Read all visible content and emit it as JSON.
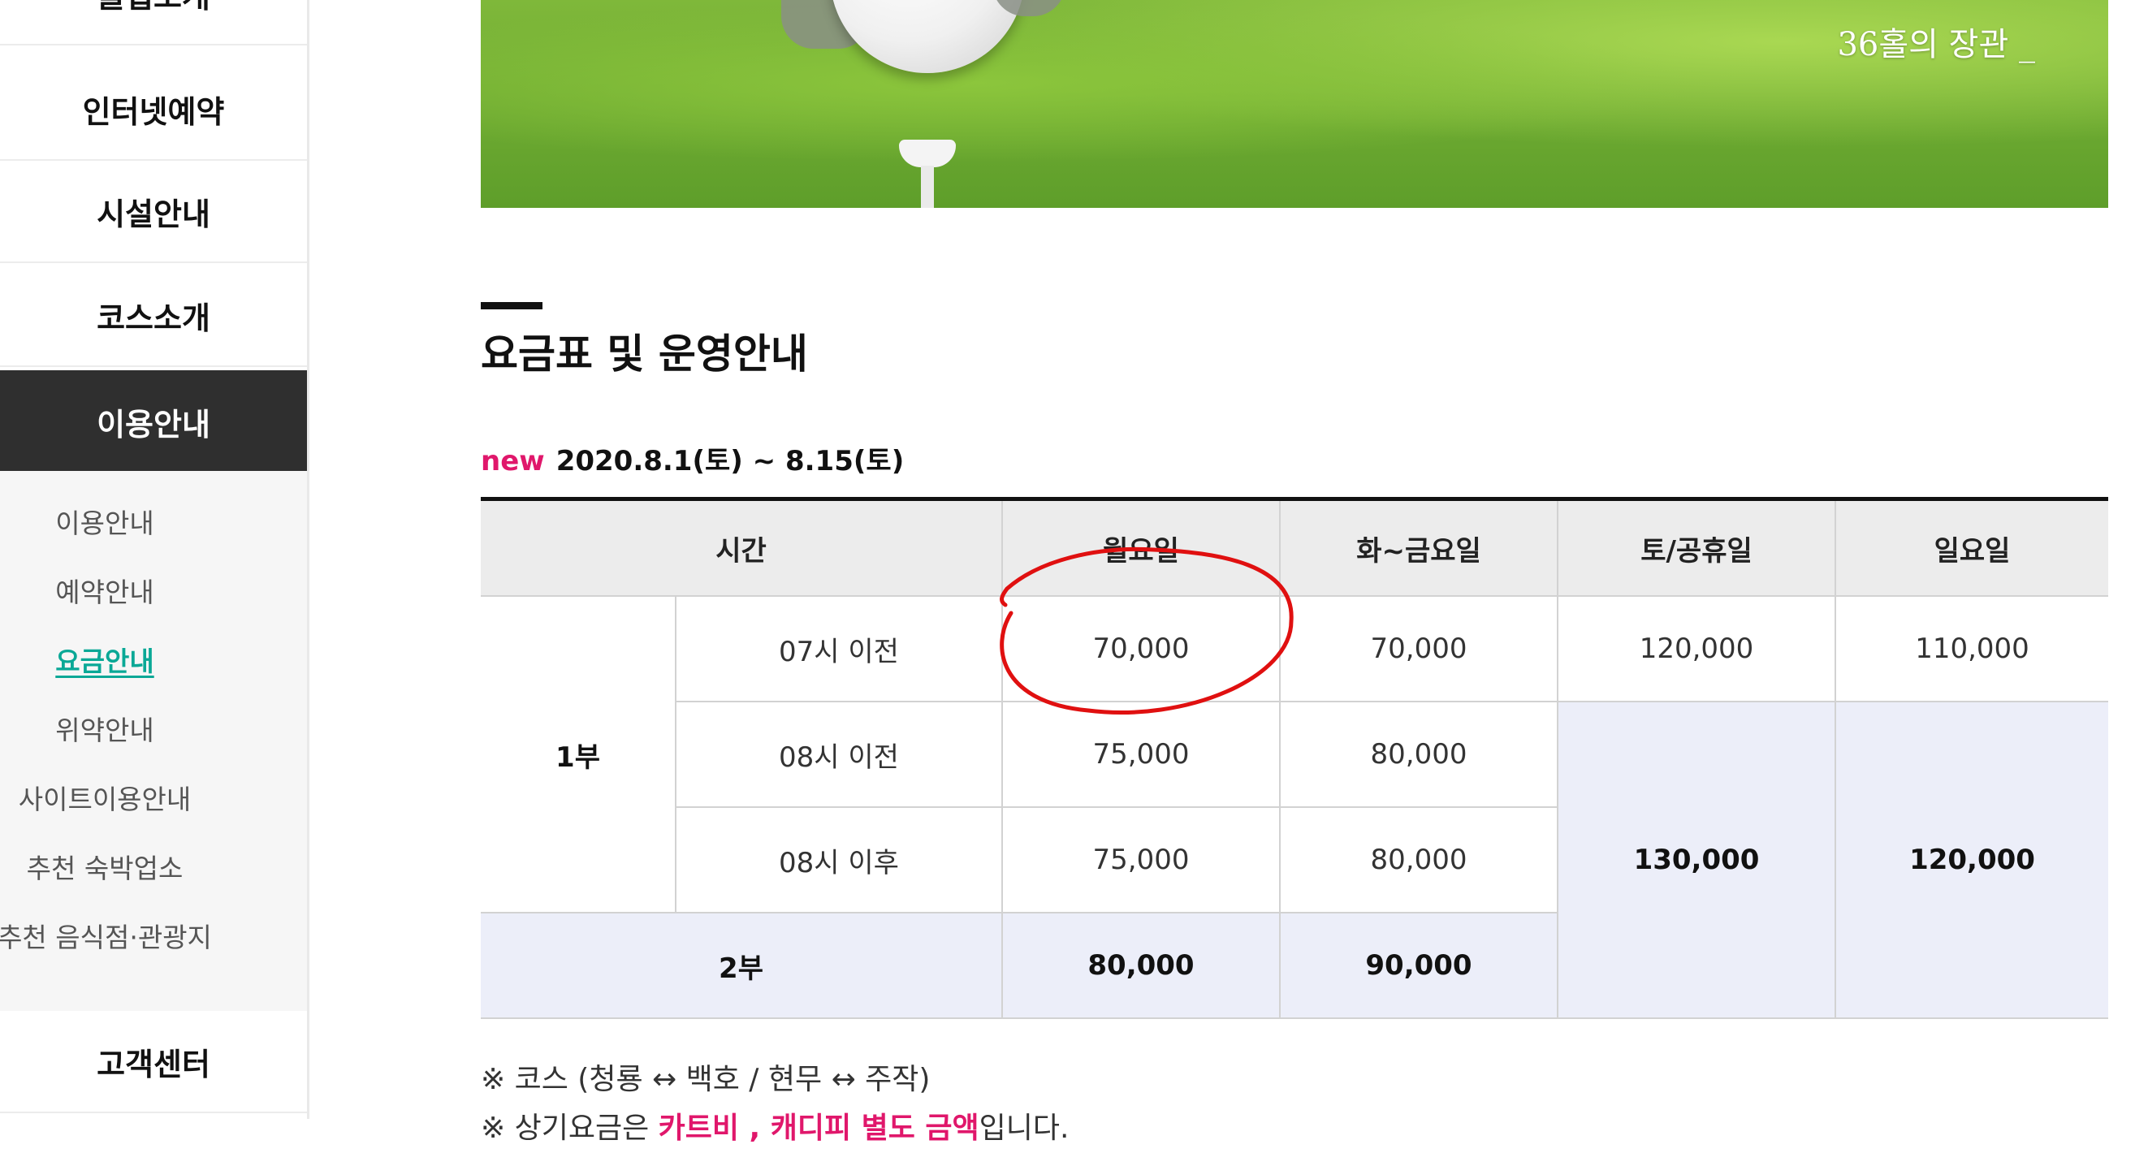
{
  "sidebar": {
    "menu": [
      {
        "label": "클럽소개"
      },
      {
        "label": "인터넷예약"
      },
      {
        "label": "시설안내"
      },
      {
        "label": "코스소개"
      },
      {
        "label": "이용안내"
      },
      {
        "label": "고객센터"
      }
    ],
    "submenu": [
      {
        "label": "이용안내"
      },
      {
        "label": "예약안내"
      },
      {
        "label": "요금안내"
      },
      {
        "label": "위약안내"
      },
      {
        "label": "사이트이용안내"
      },
      {
        "label": "추천 숙박업소"
      },
      {
        "label": "추천 음식점·관광지"
      }
    ],
    "active_menu": "이용안내",
    "selected_submenu": "요금안내"
  },
  "banner": {
    "tagline": "36홀의 장관 _"
  },
  "page": {
    "title": "요금표 및 운영안내",
    "period_badge": "new",
    "period": "2020.8.1(토) ~ 8.15(토)"
  },
  "table": {
    "headers": [
      "시간",
      "월요일",
      "화~금요일",
      "토/공휴일",
      "일요일"
    ],
    "part1_label": "1부",
    "part2_label": "2부",
    "rows": [
      {
        "time": "07시 이전",
        "mon": "70,000",
        "tue_fri": "70,000",
        "sat_hol": "120,000",
        "sun": "110,000"
      },
      {
        "time": "08시 이전",
        "mon": "75,000",
        "tue_fri": "80,000"
      },
      {
        "time": "08시 이후",
        "mon": "75,000",
        "tue_fri": "80,000"
      }
    ],
    "weekend_merged": {
      "sat_hol": "130,000",
      "sun": "120,000"
    },
    "part2": {
      "mon": "80,000",
      "tue_fri": "90,000"
    }
  },
  "notes": {
    "line1": "※ 코스 (청룡 ↔ 백호 / 현무 ↔ 주작)",
    "line2_prefix": "※ 상기요금은 ",
    "line2_highlight": "카트비 , 캐디피 별도 금액",
    "line2_suffix": "입니다."
  },
  "colors": {
    "accent_new": "#e0176b",
    "active_menu_bg": "#2f2f2f",
    "selected_submenu": "#0aa896",
    "table_header_bg": "#ececec",
    "table_shade_bg": "#eceef9",
    "annotation_circle": "#e01010"
  }
}
